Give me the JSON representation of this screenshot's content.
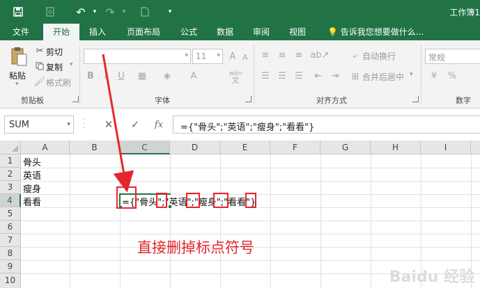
{
  "window": {
    "title": "工作簿1"
  },
  "quick_access": {
    "save": "save-icon",
    "undo": "undo-icon",
    "redo": "redo-icon"
  },
  "tabs": [
    "文件",
    "开始",
    "插入",
    "页面布局",
    "公式",
    "数据",
    "审阅",
    "视图"
  ],
  "active_tab": "开始",
  "tell_me": "告诉我您想要做什么...",
  "ribbon": {
    "clipboard": {
      "paste": "粘贴",
      "cut": "剪切",
      "copy": "复制",
      "format_painter": "格式刷",
      "label": "剪贴板"
    },
    "font": {
      "size": "11",
      "label": "字体"
    },
    "alignment": {
      "wrap": "自动换行",
      "merge": "合并后居中",
      "label": "对齐方式"
    },
    "number": {
      "format": "常规",
      "label": "数字"
    }
  },
  "formula_bar": {
    "name_box": "SUM",
    "cancel": "✕",
    "enter": "✓",
    "fx": "fx",
    "formula": "={\"骨头\";\"英语\";\"瘦身\";\"看看\"}"
  },
  "columns": [
    "A",
    "B",
    "C",
    "D",
    "E",
    "F",
    "G",
    "H",
    "I"
  ],
  "rows": [
    "1",
    "2",
    "3",
    "4",
    "5",
    "6",
    "7",
    "8",
    "9",
    "10"
  ],
  "cells": {
    "A1": "骨头",
    "A2": "英语",
    "A3": "瘦身",
    "A4": "看看"
  },
  "editing_cell_text": "={\"骨头\";\"英语\";\"瘦身\";\"看看\"}",
  "annotation": "直接删掉标点符号",
  "watermark": "Baidu 经验",
  "colors": {
    "excel_green": "#217346",
    "annotation_red": "#e6262e"
  }
}
